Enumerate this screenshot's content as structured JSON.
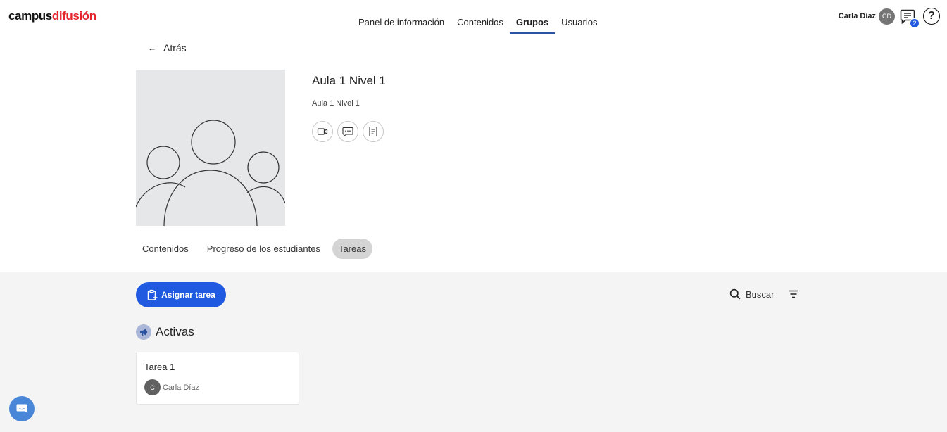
{
  "header": {
    "logo_part1": "campus",
    "logo_part2": "difusión",
    "nav": [
      {
        "label": "Panel de información"
      },
      {
        "label": "Contenidos"
      },
      {
        "label": "Grupos"
      },
      {
        "label": "Usuarios"
      }
    ],
    "active_nav": "Grupos",
    "user_name": "Carla Díaz",
    "user_initials": "CD",
    "messages_badge": "2",
    "help_symbol": "?"
  },
  "back_label": "Atrás",
  "group": {
    "title": "Aula 1 Nivel 1",
    "subtitle": "Aula 1 Nivel 1",
    "actions": [
      "video-icon",
      "chat-icon",
      "document-icon"
    ]
  },
  "tabs": [
    {
      "label": "Contenidos"
    },
    {
      "label": "Progreso de los estudiantes"
    },
    {
      "label": "Tareas"
    }
  ],
  "active_tab": "Tareas",
  "toolbar": {
    "assign_label": "Asignar tarea",
    "search_label": "Buscar"
  },
  "section": {
    "title": "Activas"
  },
  "tasks": [
    {
      "title": "Tarea 1",
      "author": "Carla Díaz",
      "author_initial": "C"
    }
  ],
  "colors": {
    "accent": "#1f5ae0",
    "brand_red": "#e3262c",
    "nav_underline": "#2a53a4"
  }
}
